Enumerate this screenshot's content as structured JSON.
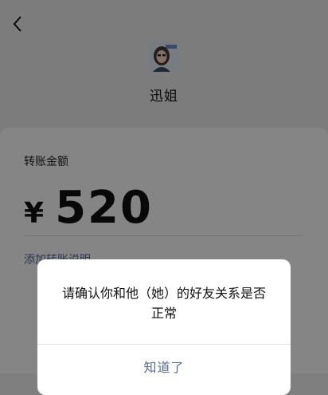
{
  "header": {
    "back_icon": "chevron-left-icon",
    "payee_name": "迅姐"
  },
  "transfer": {
    "amount_label": "转账金额",
    "currency_symbol": "¥",
    "amount": "520",
    "add_note_label": "添加转账说明"
  },
  "dialog": {
    "message": "请确认你和他（她）的好友关系是否正常",
    "confirm_label": "知道了"
  },
  "colors": {
    "link": "#576b95",
    "overlay": "rgba(0,0,0,0.48)"
  }
}
